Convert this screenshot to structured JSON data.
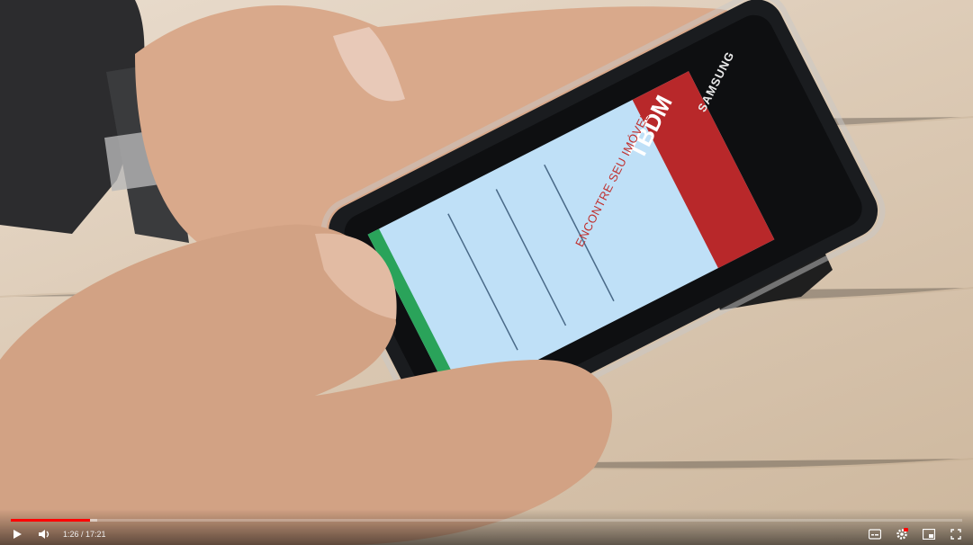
{
  "phone": {
    "brand": "SAMSUNG",
    "logo": "TBDM",
    "heading": "ENCONTRE SEU IMÓVEL"
  },
  "player": {
    "current_time": "1:26",
    "duration": "17:21",
    "time_display": "1:26 / 17:21",
    "played_fraction": 0.083,
    "loaded_fraction": 0.091,
    "accent_color": "#ff0000",
    "icons": {
      "play": "play-icon",
      "volume": "volume-icon",
      "subtitles": "subtitles-icon",
      "settings": "settings-icon",
      "miniplayer": "miniplayer-icon",
      "fullscreen": "fullscreen-icon"
    }
  }
}
